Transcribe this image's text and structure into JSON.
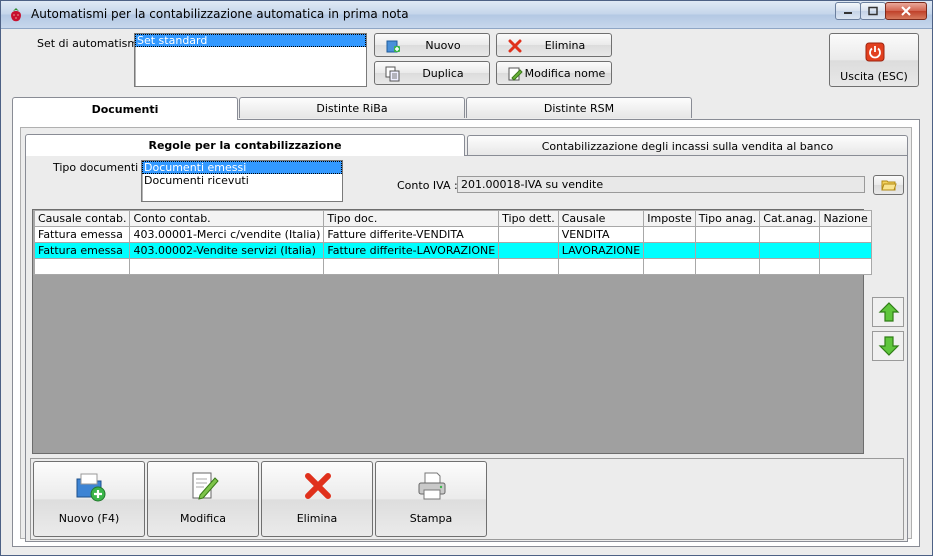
{
  "window": {
    "title": "Automatismi per la contabilizzazione automatica in prima nota"
  },
  "set": {
    "label": "Set di automatismi :",
    "items": [
      "Set standard"
    ]
  },
  "toolbar": {
    "nuovo": "Nuovo",
    "duplica": "Duplica",
    "elimina": "Elimina",
    "modifica_nome": "Modifica nome",
    "uscita": "Uscita (ESC)"
  },
  "tabs": [
    "Documenti",
    "Distinte RiBa",
    "Distinte RSM"
  ],
  "subtabs": [
    "Regole per la contabilizzazione",
    "Contabilizzazione degli incassi sulla vendita al banco"
  ],
  "tipo_documenti": {
    "label": "Tipo documenti :",
    "items": [
      "Documenti emessi",
      "Documenti ricevuti"
    ]
  },
  "conto_iva": {
    "label": "Conto IVA :",
    "value": "201.00018-IVA su vendite"
  },
  "table": {
    "columns": [
      "Causale contab.",
      "Conto contab.",
      "Tipo doc.",
      "Tipo dett.",
      "Causale",
      "Imposte",
      "Tipo anag.",
      "Cat.anag.",
      "Nazione"
    ],
    "rows": [
      [
        "Fattura emessa",
        "403.00001-Merci c/vendite (Italia)",
        "Fatture differite-VENDITA",
        "",
        "VENDITA",
        "",
        "",
        "",
        ""
      ],
      [
        "Fattura emessa",
        "403.00002-Vendite servizi (Italia)",
        "Fatture differite-LAVORAZIONE",
        "",
        "LAVORAZIONE",
        "",
        "",
        "",
        ""
      ],
      [
        "",
        "",
        "",
        "",
        "",
        "",
        "",
        "",
        ""
      ]
    ]
  },
  "actions": {
    "nuovo": "Nuovo (F4)",
    "modifica": "Modifica",
    "elimina": "Elimina",
    "stampa": "Stampa"
  },
  "colors": {
    "selection": "#3399ff",
    "highlight_row": "#00ffff",
    "grid_bg": "#a0a0a0"
  }
}
